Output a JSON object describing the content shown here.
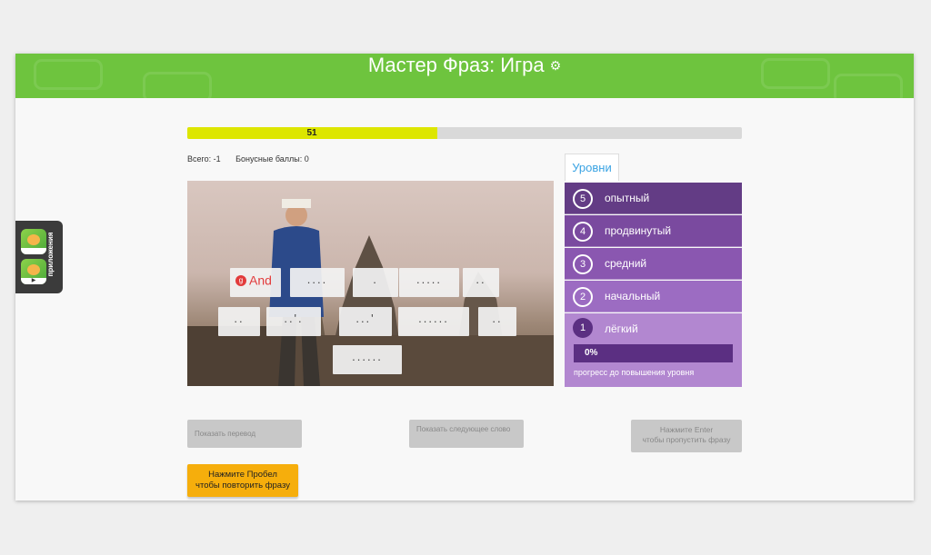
{
  "header": {
    "title": "Мастер Фраз: Игра",
    "settings_icon": "gear-icon"
  },
  "progress": {
    "value": 51,
    "label": "51",
    "fraction": 0.45
  },
  "stats": {
    "total": "Всего: -1",
    "bonus": "Бонусные баллы: 0"
  },
  "phrase_tiles": [
    {
      "text": "And",
      "revealed": true
    },
    {
      "text": "...."
    },
    {
      "text": "."
    },
    {
      "text": "....."
    },
    {
      "text": ".."
    },
    {
      "text": ".."
    },
    {
      "text": "..'."
    },
    {
      "text": "...'"
    },
    {
      "text": "......"
    },
    {
      "text": ".."
    },
    {
      "text": "......"
    }
  ],
  "levels": {
    "tab_label": "Уровни",
    "items": [
      {
        "num": "5",
        "label": "опытный",
        "color": "#633c85"
      },
      {
        "num": "4",
        "label": "продвинутый",
        "color": "#7a4a9f"
      },
      {
        "num": "3",
        "label": "средний",
        "color": "#8a57b0"
      },
      {
        "num": "2",
        "label": "начальный",
        "color": "#9c6cc2"
      }
    ],
    "active": {
      "num": "1",
      "label": "лёгкий",
      "progress_label": "0%",
      "progress_caption": "прогресс до повышения уровня"
    }
  },
  "buttons": {
    "show_translation": "Показать перевод",
    "show_next_word": "Показать следующее слово",
    "skip_line1": "Нажмите Enter",
    "skip_line2": "чтобы пропустить фразу",
    "repeat_line1": "Нажмите Пробел",
    "repeat_line2": "чтобы повторить фразу"
  },
  "apps_sidebar": {
    "label": "приложения",
    "icons": [
      "apple-app-icon",
      "google-play-app-icon"
    ]
  },
  "colors": {
    "header": "#6ec43e",
    "progress_fill": "#dde600",
    "accent_orange": "#f6ae0c",
    "level_active": "#b287d0"
  }
}
